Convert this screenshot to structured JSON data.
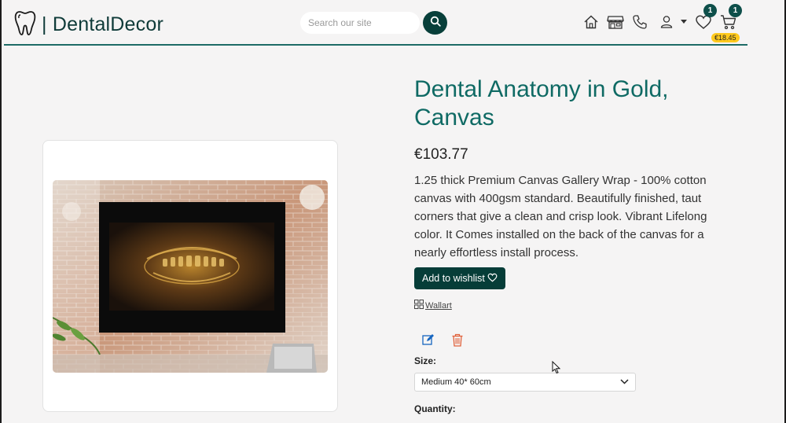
{
  "header": {
    "logo_text": "| DentalDecor",
    "search_placeholder": "Search our site",
    "wishlist_count": "1",
    "cart_count": "1",
    "cart_total": "€18.45"
  },
  "product": {
    "title": "Dental Anatomy in Gold, Canvas",
    "price": "€103.77",
    "description": "1.25 thick Premium Canvas Gallery Wrap - 100% cotton canvas with 400gsm standard. Beautifully finished, taut corners that give a clean and crisp look. Vibrant Lifelong color. It Comes installed on the back of the canvas for a nearly effortless install process.",
    "wishlist_button": "Add to wishlist",
    "category": "Wallart",
    "size_label": "Size:",
    "size_selected": "Medium 40* 60cm",
    "quantity_label": "Quantity:"
  },
  "colors": {
    "brand": "#0f6a64",
    "dark_button": "#063d38",
    "badge_bg": "#0e4f4a",
    "cart_total_bg": "#ffc91d",
    "edit_icon": "#1565c0",
    "delete_icon": "#e0603a"
  },
  "icons": [
    "tooth-icon",
    "search-icon",
    "home-icon",
    "store-icon",
    "phone-icon",
    "user-icon",
    "heart-icon",
    "cart-icon",
    "edit-icon",
    "trash-icon",
    "grid-icon",
    "chevron-down-icon"
  ]
}
